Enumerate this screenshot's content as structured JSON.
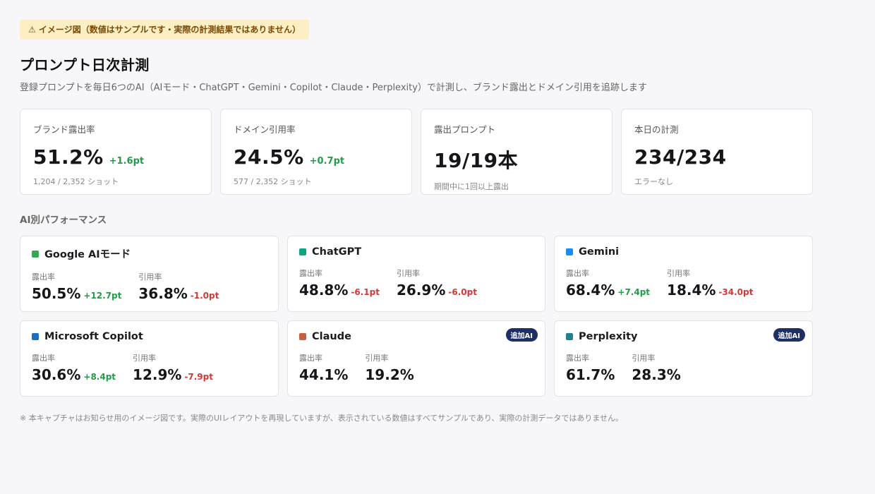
{
  "banner": "⚠ イメージ図（数値はサンプルです・実際の計測結果ではありません）",
  "title": "プロンプト日次計測",
  "subtitle": "登録プロンプトを毎日6つのAI（AIモード・ChatGPT・Gemini・Copilot・Claude・Perplexity）で計測し、ブランド露出とドメイン引用を追跡します",
  "kpis": [
    {
      "label": "ブランド露出率",
      "value": "51.2%",
      "delta": "+1.6pt",
      "sub": "1,204 / 2,352 ショット"
    },
    {
      "label": "ドメイン引用率",
      "value": "24.5%",
      "delta": "+0.7pt",
      "sub": "577 / 2,352 ショット"
    },
    {
      "label": "露出プロンプト",
      "value": "19/19本",
      "delta": "",
      "sub": "期間中に1回以上露出"
    },
    {
      "label": "本日の計測",
      "value": "234/234",
      "delta": "",
      "sub": "エラーなし"
    }
  ],
  "section_title": "AI別パフォーマンス",
  "ai_cards": [
    {
      "name": "Google AIモード",
      "color": "#34a853",
      "badge": "",
      "exposure_label": "露出率",
      "exposure": "50.5%",
      "exposure_delta": "+12.7pt",
      "exposure_trend": "pos",
      "citation_label": "引用率",
      "citation": "36.8%",
      "citation_delta": "-1.0pt",
      "citation_trend": "neg"
    },
    {
      "name": "ChatGPT",
      "color": "#10a37f",
      "badge": "",
      "exposure_label": "露出率",
      "exposure": "48.8%",
      "exposure_delta": "-6.1pt",
      "exposure_trend": "neg",
      "citation_label": "引用率",
      "citation": "26.9%",
      "citation_delta": "-6.0pt",
      "citation_trend": "neg"
    },
    {
      "name": "Gemini",
      "color": "#1a8cf0",
      "badge": "",
      "exposure_label": "露出率",
      "exposure": "68.4%",
      "exposure_delta": "+7.4pt",
      "exposure_trend": "pos",
      "citation_label": "引用率",
      "citation": "18.4%",
      "citation_delta": "-34.0pt",
      "citation_trend": "neg"
    },
    {
      "name": "Microsoft Copilot",
      "color": "#1a6fc4",
      "badge": "",
      "exposure_label": "露出率",
      "exposure": "30.6%",
      "exposure_delta": "+8.4pt",
      "exposure_trend": "pos",
      "citation_label": "引用率",
      "citation": "12.9%",
      "citation_delta": "-7.9pt",
      "citation_trend": "neg"
    },
    {
      "name": "Claude",
      "color": "#c8603e",
      "badge": "追加AI",
      "exposure_label": "露出率",
      "exposure": "44.1%",
      "exposure_delta": "",
      "exposure_trend": "",
      "citation_label": "引用率",
      "citation": "19.2%",
      "citation_delta": "",
      "citation_trend": ""
    },
    {
      "name": "Perplexity",
      "color": "#20808d",
      "badge": "追加AI",
      "exposure_label": "露出率",
      "exposure": "61.7%",
      "exposure_delta": "",
      "exposure_trend": "",
      "citation_label": "引用率",
      "citation": "28.3%",
      "citation_delta": "",
      "citation_trend": ""
    }
  ],
  "footnote": "※ 本キャプチャはお知らせ用のイメージ図です。実際のUIレイアウトを再現していますが、表示されている数値はすべてサンプルであり、実際の計測データではありません。"
}
